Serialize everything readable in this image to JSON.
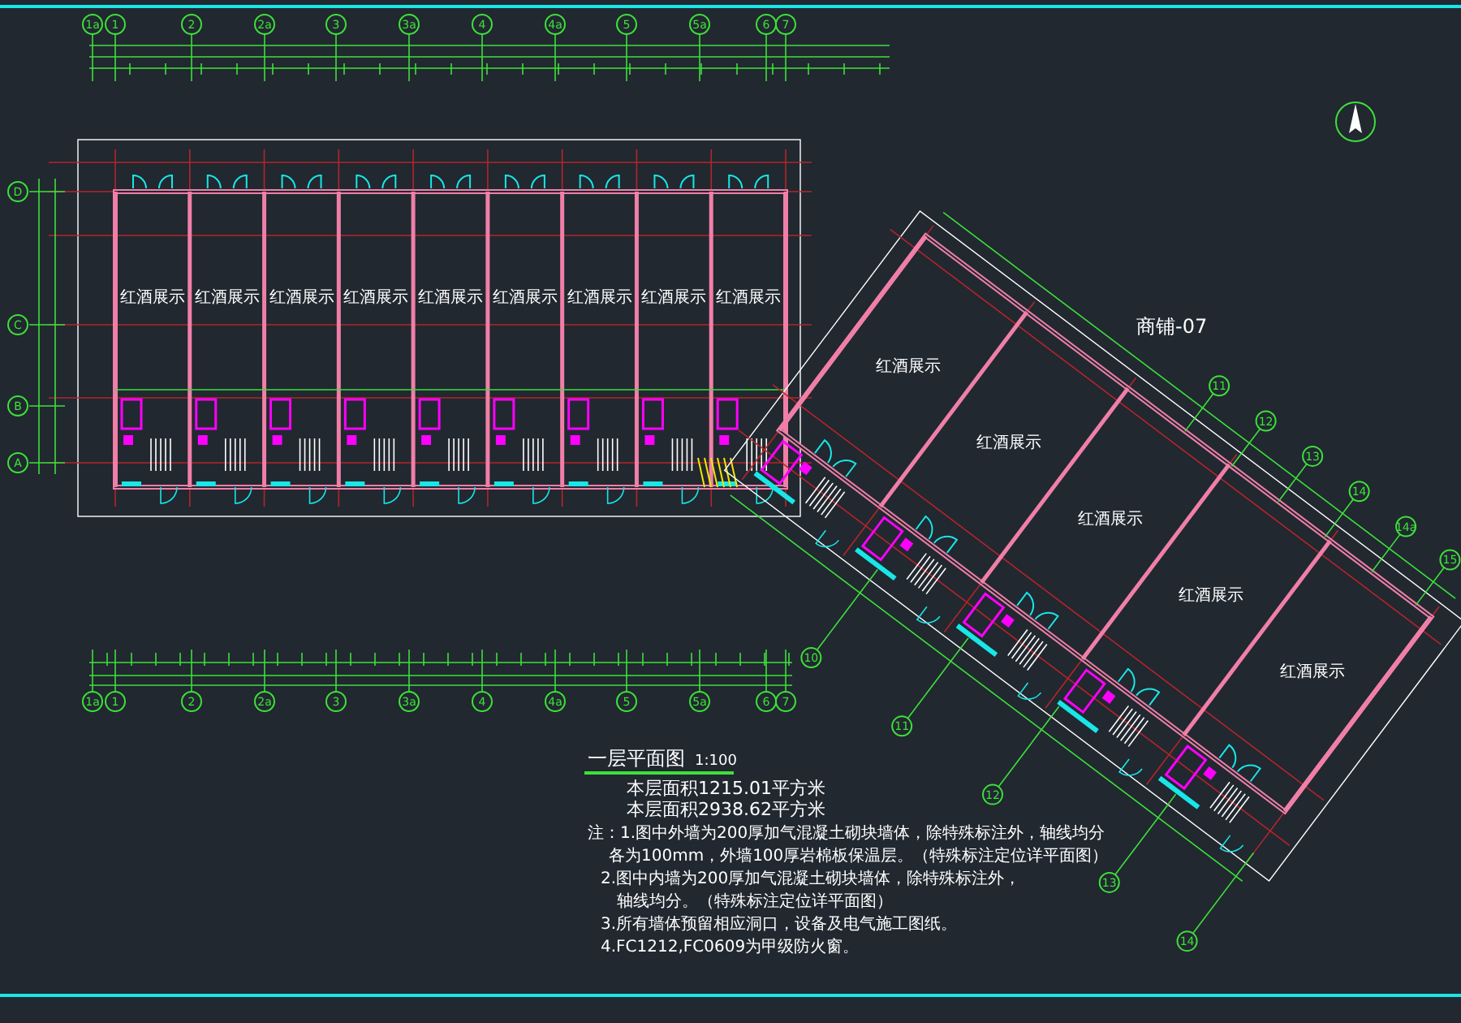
{
  "plan": {
    "axes_top": [
      {
        "label": "1a"
      },
      {
        "label": "1"
      },
      {
        "label": "2"
      },
      {
        "label": "2a"
      },
      {
        "label": "3"
      },
      {
        "label": "3a"
      },
      {
        "label": "4"
      },
      {
        "label": "4a"
      },
      {
        "label": "5"
      },
      {
        "label": "5a"
      },
      {
        "label": "6"
      },
      {
        "label": "7"
      }
    ],
    "axes_bottom": [
      {
        "label": "1a"
      },
      {
        "label": "1"
      },
      {
        "label": "2"
      },
      {
        "label": "2a"
      },
      {
        "label": "3"
      },
      {
        "label": "3a"
      },
      {
        "label": "4"
      },
      {
        "label": "4a"
      },
      {
        "label": "5"
      },
      {
        "label": "5a"
      },
      {
        "label": "6"
      },
      {
        "label": "7"
      }
    ],
    "axes_left": [
      {
        "label": "D"
      },
      {
        "label": "C"
      },
      {
        "label": "B"
      },
      {
        "label": "A"
      }
    ],
    "axes_wing_upper": [
      {
        "label": "11"
      },
      {
        "label": "12"
      },
      {
        "label": "13"
      },
      {
        "label": "14"
      },
      {
        "label": "14a"
      },
      {
        "label": "15"
      }
    ],
    "axes_wing_lower": [
      {
        "label": "10"
      },
      {
        "label": "11"
      },
      {
        "label": "12"
      },
      {
        "label": "13"
      },
      {
        "label": "14"
      }
    ],
    "rooms": [
      {
        "name": "红酒展示"
      },
      {
        "name": "红酒展示"
      },
      {
        "name": "红酒展示"
      },
      {
        "name": "红酒展示"
      },
      {
        "name": "红酒展示"
      },
      {
        "name": "红酒展示"
      },
      {
        "name": "红酒展示"
      },
      {
        "name": "红酒展示"
      },
      {
        "name": "红酒展示"
      }
    ],
    "wing_rooms": [
      {
        "name": "红酒展示"
      },
      {
        "name": "红酒展示"
      },
      {
        "name": "红酒展示"
      },
      {
        "name": "红酒展示"
      },
      {
        "name": "红酒展示"
      }
    ],
    "wing_name": "商铺-07"
  },
  "title": {
    "name": "一层平面图",
    "scale": "1:100",
    "areas": [
      "本层面积1215.01平方米",
      "本层面积2938.62平方米"
    ]
  },
  "notes": [
    "注：1.图中外墙为200厚加气混凝土砌块墙体，除特殊标注外，轴线均分",
    "各为100mm，外墙100厚岩棉板保温层。（特殊标注定位详平面图）",
    "2.图中内墙为200厚加气混凝土砌块墙体，除特殊标注外，",
    "轴线均分。（特殊标注定位详平面图）",
    "3.所有墙体预留相应洞口，设备及电气施工图纸。",
    "4.FC1212,FC0609为甲级防火窗。"
  ]
}
